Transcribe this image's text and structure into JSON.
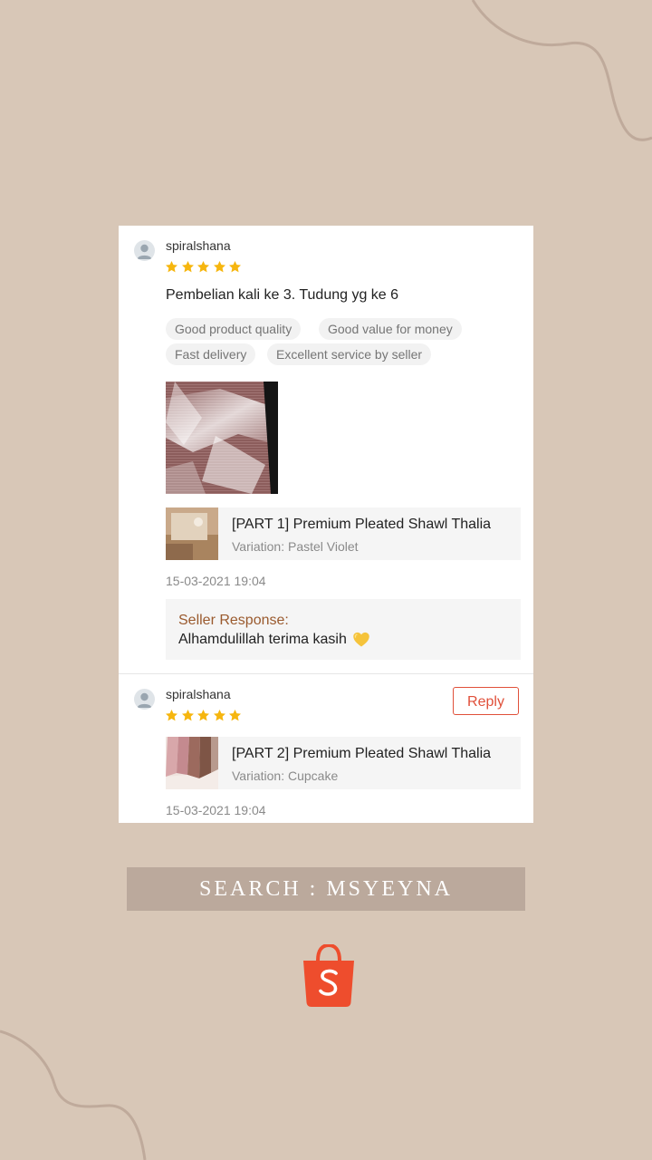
{
  "reviews": [
    {
      "username": "spiralshana",
      "rating": 5,
      "comment": "Pembelian kali ke 3. Tudung yg ke 6",
      "tags": [
        "Good product quality",
        "Good value for money",
        "Fast delivery",
        "Excellent service by seller"
      ],
      "product": {
        "name": "[PART 1] Premium Pleated Shawl Thalia",
        "variation": "Variation: Pastel Violet"
      },
      "timestamp": "15-03-2021 19:04",
      "seller_response": {
        "title": "Seller Response:",
        "text": "Alhamdulillah terima kasih"
      }
    },
    {
      "username": "spiralshana",
      "rating": 5,
      "reply_label": "Reply",
      "product": {
        "name": "[PART 2] Premium Pleated Shawl Thalia",
        "variation": "Variation: Cupcake"
      },
      "timestamp": "15-03-2021 19:04"
    }
  ],
  "banner": {
    "text": "SEARCH : MSYEYNA"
  },
  "icons": {
    "avatar": "user-avatar-icon",
    "star": "star-icon",
    "heart": "yellow-heart-icon",
    "logo": "shopee-bag-icon"
  },
  "colors": {
    "background": "#d8c7b7",
    "star": "#f6b60f",
    "accent": "#e0503a",
    "seller_title": "#9a5a2e",
    "banner": "#bba99c",
    "logo": "#ee4d2d"
  }
}
